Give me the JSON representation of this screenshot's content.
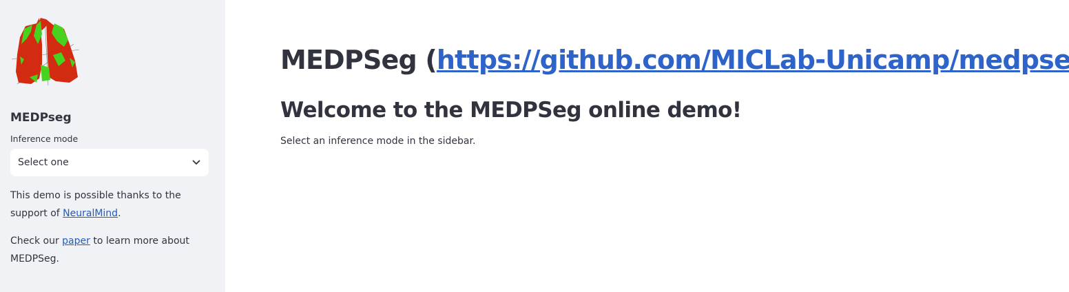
{
  "sidebar": {
    "logo_icon": "lung-segmentation-logo",
    "app_name": "MEDPseg",
    "inference_mode": {
      "label": "Inference mode",
      "selected": "Select one",
      "icon": "chevron-down-icon"
    },
    "support_text": {
      "before": "This demo is possible thanks to the support of ",
      "link": "NeuralMind",
      "after": "."
    },
    "paper_text": {
      "before": "Check our ",
      "link": "paper",
      "after": " to learn more about MEDPSeg."
    }
  },
  "main": {
    "title_prefix": "MEDPSeg (",
    "title_link": "https://github.com/MICLab-Unicamp/medpseg",
    "title_suffix": ")",
    "subtitle": "Welcome to the MEDPSeg online demo!",
    "instruction": "Select an inference mode in the sidebar."
  },
  "colors": {
    "sidebar_bg": "#f0f2f6",
    "text": "#31333f",
    "link": "#1c5bc7"
  }
}
